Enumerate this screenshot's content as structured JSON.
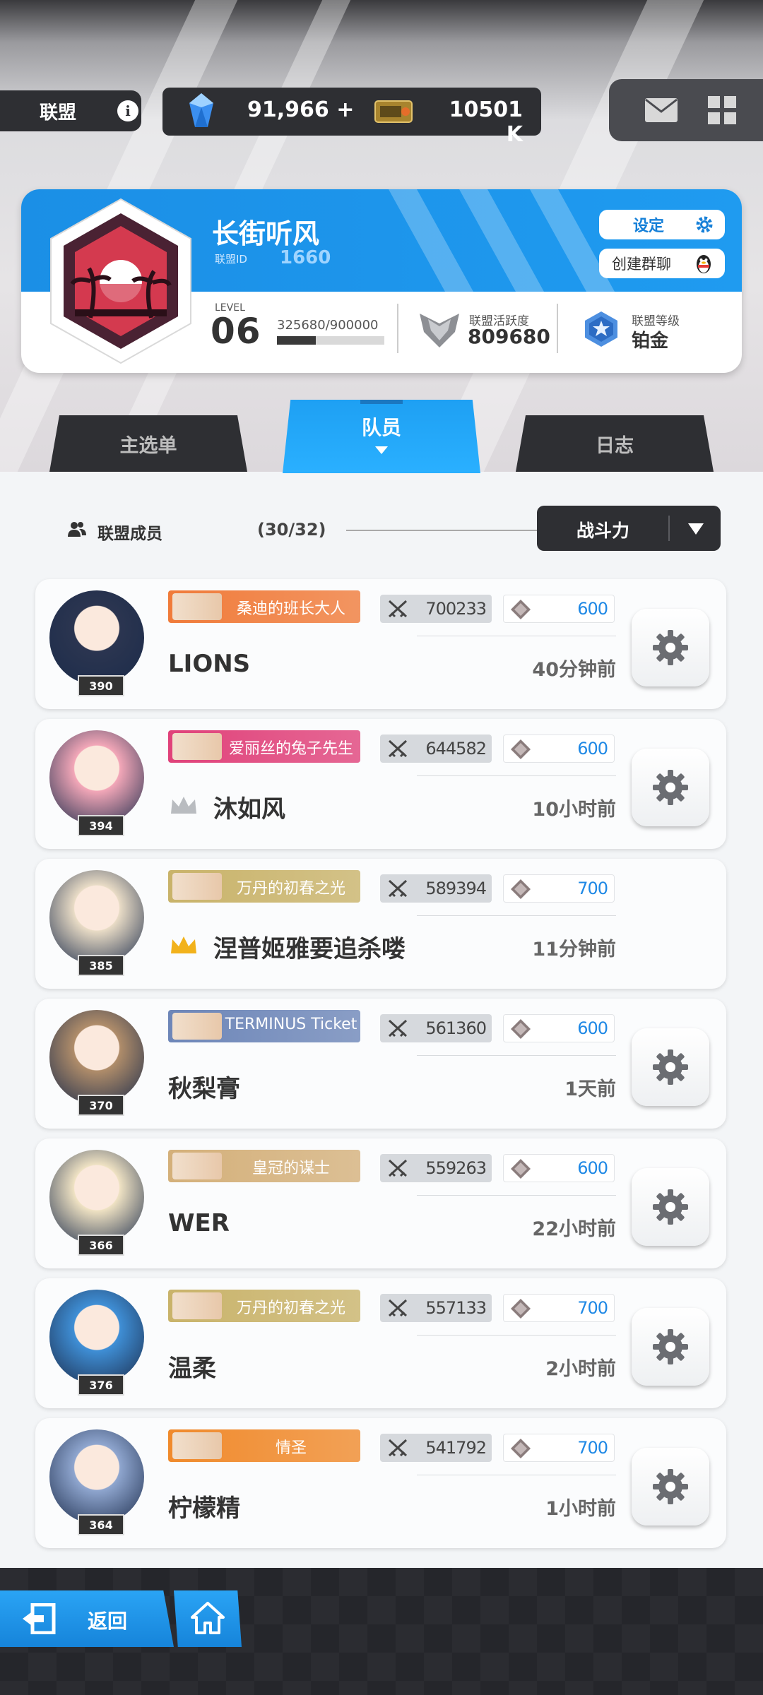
{
  "topbar": {
    "alliance_label": "联盟",
    "info_icon": "info-icon",
    "gems": "91,966 +",
    "tickets": "10501 K",
    "mail_icon": "mail-icon",
    "menu_icon": "grid-menu-icon"
  },
  "alliance": {
    "name": "长街听风",
    "id_label": "联盟ID",
    "id": "1660",
    "settings_label": "设定",
    "group_chat_label": "创建群聊",
    "level_label": "LEVEL",
    "level": "06",
    "exp": "325680/900000",
    "exp_progress": 0.362,
    "activity_label": "联盟活跃度",
    "activity": "809680",
    "rank_label": "联盟等级",
    "rank": "铂金"
  },
  "tabs": [
    {
      "label": "主选单",
      "active": false
    },
    {
      "label": "队员",
      "active": true
    },
    {
      "label": "日志",
      "active": false
    }
  ],
  "members_header": {
    "label": "联盟成员",
    "count": "(30/32)",
    "sort_label": "战斗力"
  },
  "members": [
    {
      "name": "LIONS",
      "level": "390",
      "title": "桑迪的班长大人",
      "title_color": "#f07b3a",
      "power": "700233",
      "honor": "600",
      "time": "40分钟前",
      "crown": "none",
      "settings": true,
      "avatar_color": "#2b3550"
    },
    {
      "name": "沐如风",
      "level": "394",
      "title": "爱丽丝的兔子先生",
      "title_color": "#e0427a",
      "power": "644582",
      "honor": "600",
      "time": "10小时前",
      "crown": "silver",
      "settings": true,
      "avatar_color": "#f3a7b8"
    },
    {
      "name": "涅普姬雅要追杀喽",
      "level": "385",
      "title": "万丹的初春之光",
      "title_color": "#c9b36a",
      "power": "589394",
      "honor": "700",
      "time": "11分钟前",
      "crown": "gold",
      "settings": false,
      "avatar_color": "#e9dcc6"
    },
    {
      "name": "秋梨膏",
      "level": "370",
      "title": "TERMINUS Ticket",
      "title_color": "#6d86b8",
      "power": "561360",
      "honor": "600",
      "time": "1天前",
      "crown": "none",
      "settings": true,
      "avatar_color": "#b08d6a"
    },
    {
      "name": "WER",
      "level": "366",
      "title": "皇冠的谋士",
      "title_color": "#d4b07a",
      "power": "559263",
      "honor": "600",
      "time": "22小时前",
      "crown": "none",
      "settings": true,
      "avatar_color": "#efe2c3"
    },
    {
      "name": "温柔",
      "level": "376",
      "title": "万丹的初春之光",
      "title_color": "#c9b36a",
      "power": "557133",
      "honor": "700",
      "time": "2小时前",
      "crown": "none",
      "settings": true,
      "avatar_color": "#3f8fd6"
    },
    {
      "name": "柠檬精",
      "level": "364",
      "title": "情圣",
      "title_color": "#f08a2c",
      "power": "541792",
      "honor": "700",
      "time": "1小时前",
      "crown": "none",
      "settings": true,
      "avatar_color": "#8fa6cf"
    }
  ],
  "bottom": {
    "back_label": "返回",
    "home_icon": "home-icon"
  }
}
